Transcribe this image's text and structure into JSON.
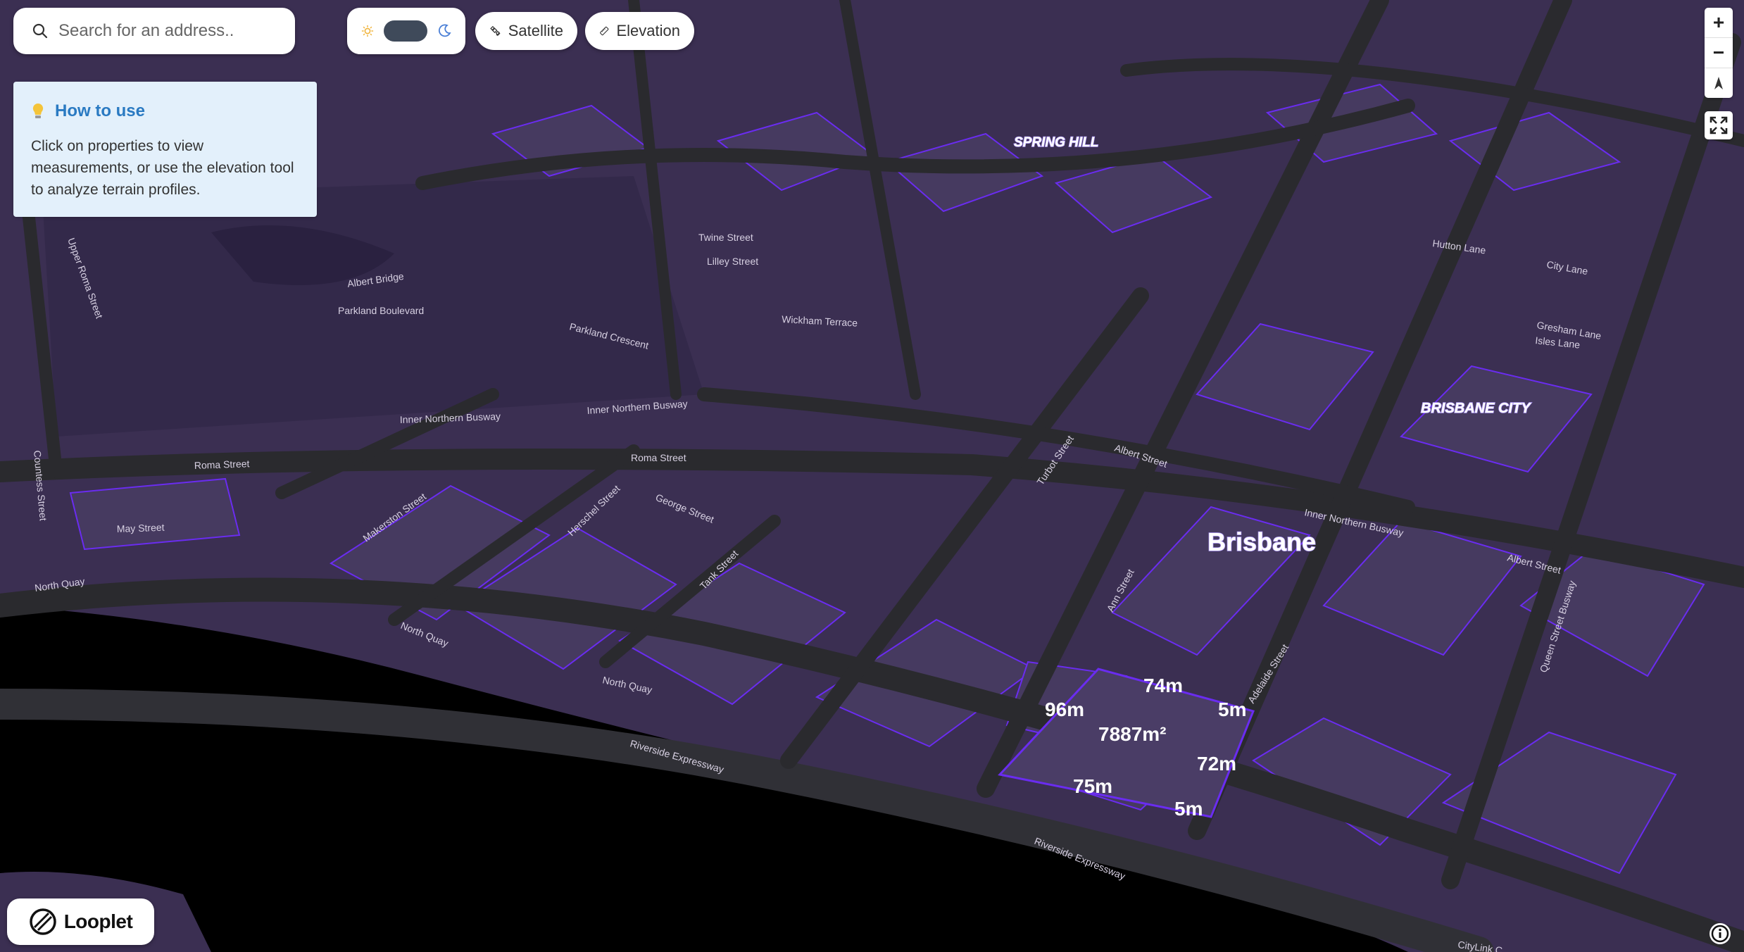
{
  "search": {
    "placeholder": "Search for an address.."
  },
  "toolbar": {
    "satellite_label": "Satellite",
    "elevation_label": "Elevation"
  },
  "how_to_use": {
    "title": "How to use",
    "body": "Click on properties to view measurements, or use the elevation tool to analyze terrain profiles."
  },
  "map": {
    "suburbs": [
      "SPRING HILL",
      "BRISBANE CITY"
    ],
    "city_label": "Brisbane",
    "streets": [
      "Wickham Terrace",
      "Parkland Boulevard",
      "Parkland Crescent",
      "Inner Northern Busway",
      "Roma Street",
      "May Street",
      "North Quay",
      "Makerston Street",
      "Herschel Street",
      "George Street",
      "Tank Street",
      "Turbot Street",
      "Albert Street",
      "Ann Street",
      "Adelaide Street",
      "Queen Street Busway",
      "Riverside Expressway",
      "Twine Street",
      "Lilley Street",
      "Hutton Lane",
      "Gresham Lane",
      "Isles Lane",
      "City Lane",
      "CityLink C",
      "Countess Street",
      "Upper Roma Street",
      "Albert Bridge"
    ],
    "measurements": {
      "area": "7887m²",
      "edges": [
        "74m",
        "96m",
        "5m",
        "72m",
        "75m",
        "5m"
      ]
    }
  },
  "brand": {
    "name": "Looplet"
  },
  "colors": {
    "map_base": "#3b2f52",
    "building_outline": "#6a2cf0",
    "road": "#2a2a2e",
    "water": "#000000",
    "howto_bg": "#e3f0fb",
    "howto_title": "#2a7ac2"
  },
  "icons": {
    "search": "search-icon",
    "sun": "sun-icon",
    "moon": "moon-icon",
    "satellite": "satellite-icon",
    "elevation": "ruler-icon",
    "lightbulb": "lightbulb-icon",
    "zoom_in": "plus-icon",
    "zoom_out": "minus-icon",
    "compass": "compass-icon",
    "fullscreen": "fullscreen-icon",
    "info": "info-icon"
  }
}
